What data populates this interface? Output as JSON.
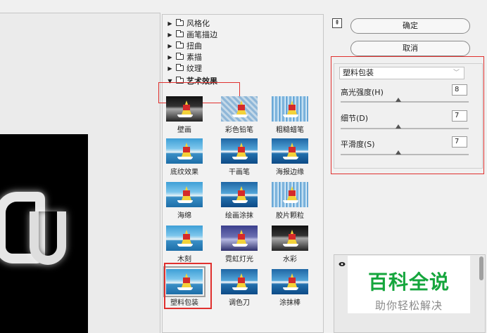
{
  "categories": [
    {
      "label": "风格化",
      "expanded": false
    },
    {
      "label": "画笔描边",
      "expanded": false
    },
    {
      "label": "扭曲",
      "expanded": false
    },
    {
      "label": "素描",
      "expanded": false
    },
    {
      "label": "纹理",
      "expanded": false
    },
    {
      "label": "艺术效果",
      "expanded": true
    }
  ],
  "filters": [
    {
      "label": "壁画"
    },
    {
      "label": "彩色铅笔"
    },
    {
      "label": "粗糙蜡笔"
    },
    {
      "label": "底纹效果"
    },
    {
      "label": "干画笔"
    },
    {
      "label": "海报边缘"
    },
    {
      "label": "海绵"
    },
    {
      "label": "绘画涂抹"
    },
    {
      "label": "胶片颗粒"
    },
    {
      "label": "木刻"
    },
    {
      "label": "霓虹灯光"
    },
    {
      "label": "水彩"
    },
    {
      "label": "塑料包装",
      "selected": true
    },
    {
      "label": "调色刀"
    },
    {
      "label": "涂抹棒"
    }
  ],
  "buttons": {
    "ok": "确定",
    "cancel": "取消"
  },
  "filter_select": {
    "value": "塑料包装"
  },
  "params": [
    {
      "label": "高光强度(H)",
      "value": "8",
      "level": 0.45
    },
    {
      "label": "细节(D)",
      "value": "7",
      "level": 0.45
    },
    {
      "label": "平滑度(S)",
      "value": "7",
      "level": 0.45
    }
  ],
  "watermark": {
    "title": "百科全说",
    "subtitle": "助你轻松解决"
  },
  "colors": {
    "highlight": "#e0302e",
    "watermark_green": "#15a63d"
  }
}
